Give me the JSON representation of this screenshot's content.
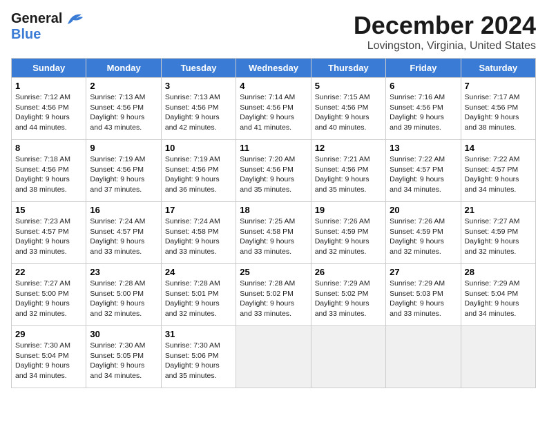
{
  "logo": {
    "line1": "General",
    "line2": "Blue"
  },
  "title": "December 2024",
  "location": "Lovingston, Virginia, United States",
  "weekdays": [
    "Sunday",
    "Monday",
    "Tuesday",
    "Wednesday",
    "Thursday",
    "Friday",
    "Saturday"
  ],
  "weeks": [
    [
      {
        "day": 1,
        "sunrise": "7:12 AM",
        "sunset": "4:56 PM",
        "daylight": "9 hours and 44 minutes."
      },
      {
        "day": 2,
        "sunrise": "7:13 AM",
        "sunset": "4:56 PM",
        "daylight": "9 hours and 43 minutes."
      },
      {
        "day": 3,
        "sunrise": "7:13 AM",
        "sunset": "4:56 PM",
        "daylight": "9 hours and 42 minutes."
      },
      {
        "day": 4,
        "sunrise": "7:14 AM",
        "sunset": "4:56 PM",
        "daylight": "9 hours and 41 minutes."
      },
      {
        "day": 5,
        "sunrise": "7:15 AM",
        "sunset": "4:56 PM",
        "daylight": "9 hours and 40 minutes."
      },
      {
        "day": 6,
        "sunrise": "7:16 AM",
        "sunset": "4:56 PM",
        "daylight": "9 hours and 39 minutes."
      },
      {
        "day": 7,
        "sunrise": "7:17 AM",
        "sunset": "4:56 PM",
        "daylight": "9 hours and 38 minutes."
      }
    ],
    [
      {
        "day": 8,
        "sunrise": "7:18 AM",
        "sunset": "4:56 PM",
        "daylight": "9 hours and 38 minutes."
      },
      {
        "day": 9,
        "sunrise": "7:19 AM",
        "sunset": "4:56 PM",
        "daylight": "9 hours and 37 minutes."
      },
      {
        "day": 10,
        "sunrise": "7:19 AM",
        "sunset": "4:56 PM",
        "daylight": "9 hours and 36 minutes."
      },
      {
        "day": 11,
        "sunrise": "7:20 AM",
        "sunset": "4:56 PM",
        "daylight": "9 hours and 35 minutes."
      },
      {
        "day": 12,
        "sunrise": "7:21 AM",
        "sunset": "4:56 PM",
        "daylight": "9 hours and 35 minutes."
      },
      {
        "day": 13,
        "sunrise": "7:22 AM",
        "sunset": "4:57 PM",
        "daylight": "9 hours and 34 minutes."
      },
      {
        "day": 14,
        "sunrise": "7:22 AM",
        "sunset": "4:57 PM",
        "daylight": "9 hours and 34 minutes."
      }
    ],
    [
      {
        "day": 15,
        "sunrise": "7:23 AM",
        "sunset": "4:57 PM",
        "daylight": "9 hours and 33 minutes."
      },
      {
        "day": 16,
        "sunrise": "7:24 AM",
        "sunset": "4:57 PM",
        "daylight": "9 hours and 33 minutes."
      },
      {
        "day": 17,
        "sunrise": "7:24 AM",
        "sunset": "4:58 PM",
        "daylight": "9 hours and 33 minutes."
      },
      {
        "day": 18,
        "sunrise": "7:25 AM",
        "sunset": "4:58 PM",
        "daylight": "9 hours and 33 minutes."
      },
      {
        "day": 19,
        "sunrise": "7:26 AM",
        "sunset": "4:59 PM",
        "daylight": "9 hours and 32 minutes."
      },
      {
        "day": 20,
        "sunrise": "7:26 AM",
        "sunset": "4:59 PM",
        "daylight": "9 hours and 32 minutes."
      },
      {
        "day": 21,
        "sunrise": "7:27 AM",
        "sunset": "4:59 PM",
        "daylight": "9 hours and 32 minutes."
      }
    ],
    [
      {
        "day": 22,
        "sunrise": "7:27 AM",
        "sunset": "5:00 PM",
        "daylight": "9 hours and 32 minutes."
      },
      {
        "day": 23,
        "sunrise": "7:28 AM",
        "sunset": "5:00 PM",
        "daylight": "9 hours and 32 minutes."
      },
      {
        "day": 24,
        "sunrise": "7:28 AM",
        "sunset": "5:01 PM",
        "daylight": "9 hours and 32 minutes."
      },
      {
        "day": 25,
        "sunrise": "7:28 AM",
        "sunset": "5:02 PM",
        "daylight": "9 hours and 33 minutes."
      },
      {
        "day": 26,
        "sunrise": "7:29 AM",
        "sunset": "5:02 PM",
        "daylight": "9 hours and 33 minutes."
      },
      {
        "day": 27,
        "sunrise": "7:29 AM",
        "sunset": "5:03 PM",
        "daylight": "9 hours and 33 minutes."
      },
      {
        "day": 28,
        "sunrise": "7:29 AM",
        "sunset": "5:04 PM",
        "daylight": "9 hours and 34 minutes."
      }
    ],
    [
      {
        "day": 29,
        "sunrise": "7:30 AM",
        "sunset": "5:04 PM",
        "daylight": "9 hours and 34 minutes."
      },
      {
        "day": 30,
        "sunrise": "7:30 AM",
        "sunset": "5:05 PM",
        "daylight": "9 hours and 34 minutes."
      },
      {
        "day": 31,
        "sunrise": "7:30 AM",
        "sunset": "5:06 PM",
        "daylight": "9 hours and 35 minutes."
      },
      null,
      null,
      null,
      null
    ]
  ]
}
